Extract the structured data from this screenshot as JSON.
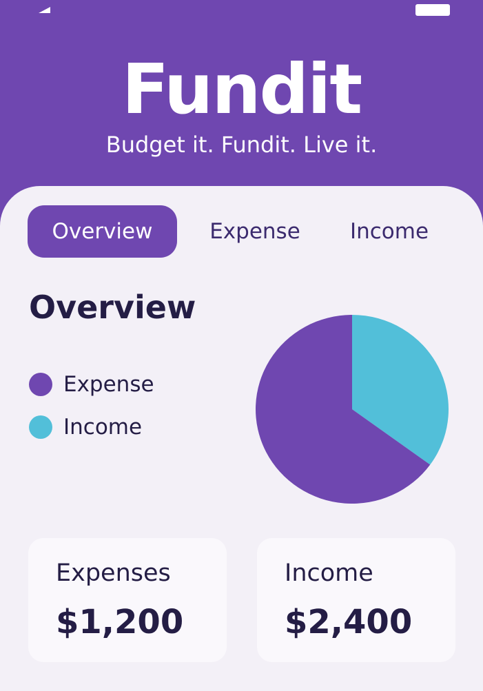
{
  "app": {
    "title": "Fundit",
    "tagline": "Budget it. Fundit. Live it."
  },
  "colors": {
    "brand": "#6f47b0",
    "expense": "#6f47b0",
    "income": "#52bfd9",
    "background": "#f3f0f7",
    "text": "#241d45"
  },
  "tabs": [
    {
      "label": "Overview",
      "active": true
    },
    {
      "label": "Expense",
      "active": false
    },
    {
      "label": "Income",
      "active": false
    }
  ],
  "overview": {
    "title": "Overview",
    "legend": [
      {
        "label": "Expense",
        "color": "#6f47b0"
      },
      {
        "label": "Income",
        "color": "#52bfd9"
      }
    ]
  },
  "chart_data": {
    "type": "pie",
    "slices": [
      {
        "label": "Expense",
        "value": 0.65,
        "color": "#6f47b0"
      },
      {
        "label": "Income",
        "value": 0.35,
        "color": "#52bfd9"
      }
    ]
  },
  "cards": {
    "expenses": {
      "label": "Expenses",
      "value": "$1,200"
    },
    "income": {
      "label": "Income",
      "value": "$2,400"
    }
  },
  "status_bar": {
    "icons": [
      "signal-icon",
      "battery-icon"
    ]
  }
}
